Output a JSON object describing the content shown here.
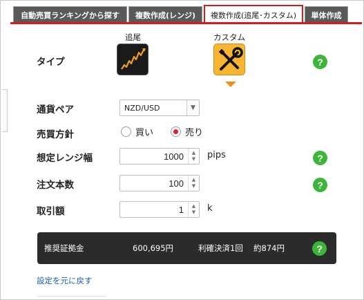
{
  "tabs": [
    {
      "label": "自動売買ランキングから探す",
      "active": false
    },
    {
      "label": "複数作成(レンジ)",
      "active": false
    },
    {
      "label": "複数作成(追尾･カスタム)",
      "active": true
    },
    {
      "label": "単体作成",
      "active": false
    }
  ],
  "type_row": {
    "label": "タイプ",
    "options": [
      {
        "caption": "追尾",
        "icon": "trailing-chart-icon",
        "selected": false
      },
      {
        "caption": "カスタム",
        "icon": "wrench-screwdriver-icon",
        "selected": true
      }
    ]
  },
  "currency_pair": {
    "label": "通貨ペア",
    "value": "NZD/USD"
  },
  "trade_direction": {
    "label": "売買方針",
    "options": [
      {
        "label": "買い",
        "checked": false
      },
      {
        "label": "売り",
        "checked": true
      }
    ]
  },
  "range_width": {
    "label": "想定レンジ幅",
    "value": "1000",
    "unit": "pips"
  },
  "order_count": {
    "label": "注文本数",
    "value": "100"
  },
  "trade_amount": {
    "label": "取引額",
    "value": "1",
    "unit": "k"
  },
  "summary": {
    "label": "推奨証拠金",
    "margin": "600,695円",
    "settlement": "利確決済1回",
    "approx": "約874円"
  },
  "reset_link": "設定を元に戻す",
  "help_glyph": "?",
  "colors": {
    "accent_red": "#d8191e",
    "help_green": "#3db53a",
    "custom_icon_bg": "#f7b532",
    "summary_bg": "#2b2b2b"
  }
}
